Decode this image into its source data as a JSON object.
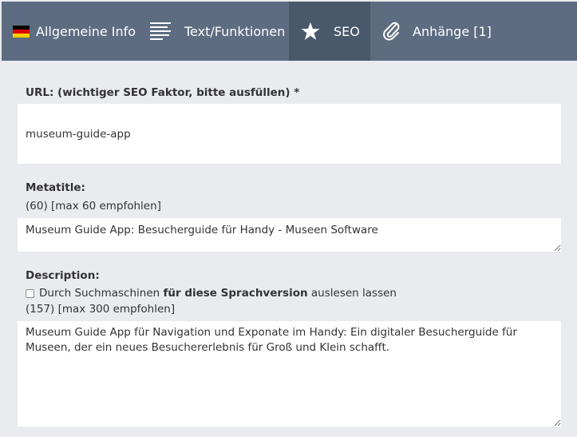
{
  "tabs": {
    "allgemein": {
      "label": "Allgemeine Info",
      "icon": "germany-flag-icon"
    },
    "text": {
      "label": "Text/Funktionen",
      "icon": "text-lines-icon"
    },
    "seo": {
      "label": "SEO",
      "icon": "star-icon",
      "active": true
    },
    "anhaenge": {
      "label": "Anhänge [1]",
      "icon": "paperclip-icon"
    }
  },
  "url": {
    "label": "URL: (wichtiger SEO Faktor, bitte ausfüllen) *",
    "value": "museum-guide-app"
  },
  "metatitle": {
    "label": "Metatitle:",
    "counter": "(60) [max 60 empfohlen]",
    "value": "Museum Guide App: Besucherguide für Handy - Museen Software"
  },
  "description": {
    "label": "Description:",
    "checkbox_prefix": "Durch Suchmaschinen",
    "checkbox_bold": "für diese Sprachversion",
    "checkbox_suffix": "auslesen lassen",
    "checkbox_checked": false,
    "counter": "(157) [max 300 empfohlen]",
    "value": "Museum Guide App für Navigation und Exponate im Handy: Ein digitaler Besucherguide für Museen, der ein neues Besuchererlebnis für Groß und Klein schafft."
  },
  "colors": {
    "tabbar": "#5d6c81",
    "tab_active": "#4a586b",
    "panel": "#eaebee"
  }
}
